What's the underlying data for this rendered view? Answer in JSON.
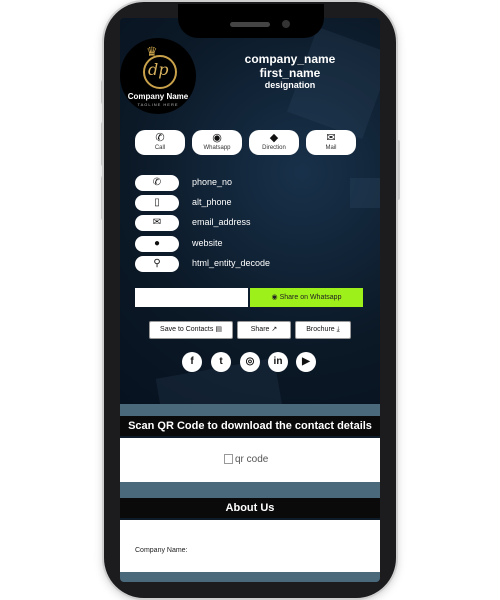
{
  "profile": {
    "company_label": "Company Name",
    "tagline": "TAGLINE HERE",
    "monogram": "dp",
    "company_name": "company_name",
    "first_name": "first_name",
    "designation": "designation"
  },
  "actions": [
    {
      "label": "Call",
      "icon": "phone-icon",
      "glyph": "✆"
    },
    {
      "label": "Whatsapp",
      "icon": "whatsapp-icon",
      "glyph": "◉"
    },
    {
      "label": "Direction",
      "icon": "direction-icon",
      "glyph": "◆"
    },
    {
      "label": "Mail",
      "icon": "mail-icon",
      "glyph": "✉"
    }
  ],
  "contact_rows": [
    {
      "text": "phone_no",
      "icon": "phone-icon",
      "glyph": "✆"
    },
    {
      "text": "alt_phone",
      "icon": "mobile-icon",
      "glyph": "▯"
    },
    {
      "text": "email_address",
      "icon": "email-icon",
      "glyph": "✉"
    },
    {
      "text": "website",
      "icon": "globe-icon",
      "glyph": "●"
    },
    {
      "text": "html_entity_decode",
      "icon": "location-pin-icon",
      "glyph": "⚲"
    }
  ],
  "share": {
    "input_value": "",
    "whatsapp_button": "Share on Whatsapp",
    "whatsapp_color": "#9ef01a"
  },
  "buttons": {
    "save": "Save to Contacts",
    "share": "Share",
    "brochure": "Brochure"
  },
  "social": [
    {
      "name": "facebook-icon",
      "glyph": "f"
    },
    {
      "name": "twitter-icon",
      "glyph": "t"
    },
    {
      "name": "instagram-icon",
      "glyph": "◎"
    },
    {
      "name": "linkedin-icon",
      "glyph": "in"
    },
    {
      "name": "youtube-icon",
      "glyph": "▶"
    }
  ],
  "qr": {
    "heading": "Scan QR Code to download the contact details",
    "alt": "qr code"
  },
  "about": {
    "heading": "About Us",
    "company_name_label": "Company Name:"
  },
  "colors": {
    "background": "#0e1c29",
    "accent_gold": "#c9a14a",
    "header_band": "#0a0a0a"
  }
}
